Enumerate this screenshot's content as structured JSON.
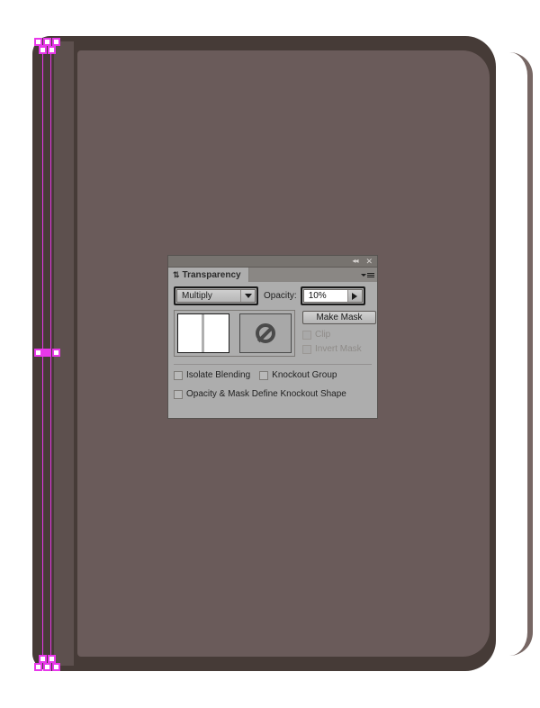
{
  "artwork": {
    "description": "vector illustration of a closed notebook / folder with rounded corners",
    "colors": {
      "cover_dark": "#463b37",
      "cover_interior": "#6a5b5a",
      "spine": "#5d504e",
      "edge_highlight": "#776764",
      "selection": "#e838ea",
      "canvas_background": "#ffffff"
    }
  },
  "panel": {
    "title": "Transparency",
    "titlebar": {
      "collapse_icon": "◂◂",
      "close_icon": "✕"
    },
    "tab": {
      "grip_icon": "⇅",
      "label": "Transparency"
    },
    "menu_icon": "panel-menu-icon",
    "blend_mode": {
      "value": "Multiply",
      "arrow_icon": "chevron-down-icon"
    },
    "opacity": {
      "label": "Opacity:",
      "value": "10%",
      "arrow_icon": "caret-right-icon"
    },
    "thumbnails": {
      "artwork_thumb_name": "artwork-thumbnail",
      "mask_thumb_name": "mask-thumbnail",
      "mask_icon": "no-symbol-icon"
    },
    "mask_controls": {
      "make_mask_label": "Make Mask",
      "clip_label": "Clip",
      "clip_checked": false,
      "clip_enabled": false,
      "invert_mask_label": "Invert Mask",
      "invert_mask_checked": false,
      "invert_mask_enabled": false
    },
    "options": {
      "isolate_blending_label": "Isolate Blending",
      "isolate_blending_checked": false,
      "knockout_group_label": "Knockout Group",
      "knockout_group_checked": false,
      "opacity_mask_knockout_label": "Opacity & Mask Define Knockout Shape",
      "opacity_mask_knockout_checked": false
    }
  }
}
